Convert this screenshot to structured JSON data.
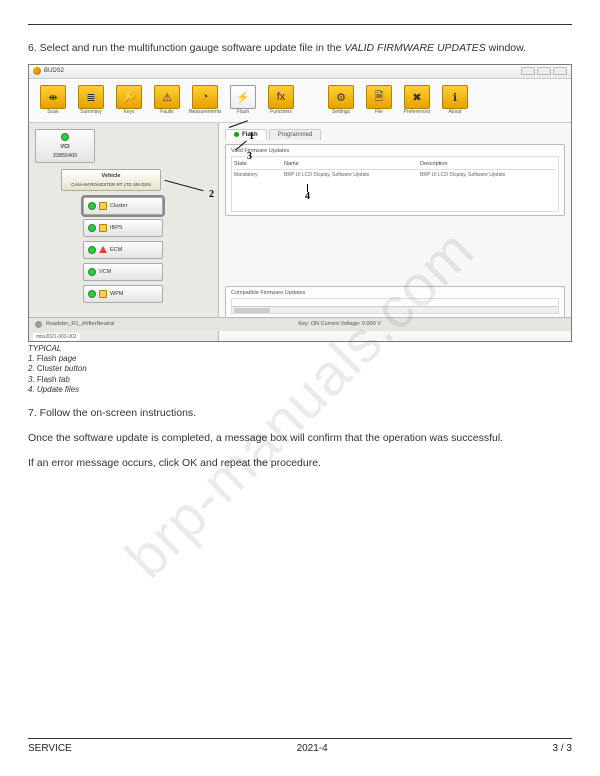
{
  "step6_prefix": "6. Select and run the multifunction gauge software update file in the ",
  "step6_italic": "VALID FIRMWARE UPDATES",
  "step6_suffix": " window.",
  "app_title": "BUDS2",
  "toolbar": [
    {
      "icon": "⇼",
      "label": "Scan"
    },
    {
      "icon": "≣",
      "label": "Summary"
    },
    {
      "icon": "🔑",
      "label": "Keys"
    },
    {
      "icon": "⚠",
      "label": "Faults"
    },
    {
      "icon": "◔",
      "label": "Measurements"
    },
    {
      "icon": "⚡",
      "label": "Flash"
    },
    {
      "icon": "fx",
      "label": "Functions"
    },
    {
      "icon": "⚙",
      "label": "Settings"
    },
    {
      "icon": "🗎",
      "label": "File"
    },
    {
      "icon": "✖",
      "label": "Preferences"
    },
    {
      "icon": "ℹ",
      "label": "About"
    }
  ],
  "tree": {
    "vci": {
      "title": "VCI",
      "sub": "33855400"
    },
    "vehicle": {
      "title": "Vehicle",
      "sub": "CAN-AM ROADSTER RT LTD SM GEN"
    },
    "modules": [
      {
        "name": "Cluster",
        "status": "green",
        "flag": "sp",
        "cls": "cluster"
      },
      {
        "name": "IBPS",
        "status": "green",
        "flag": "sp",
        "cls": ""
      },
      {
        "name": "ECM",
        "status": "green",
        "flag": "tri",
        "cls": ""
      },
      {
        "name": "VCM",
        "status": "green",
        "flag": "",
        "cls": ""
      },
      {
        "name": "WPM",
        "status": "green",
        "flag": "sp",
        "cls": ""
      }
    ]
  },
  "tabs": {
    "flash": "Flash",
    "prog": "Programmed"
  },
  "valid_panel_label": "Valid Firmware Updates",
  "compat_panel_label": "Compatible Firmware Updates",
  "headers": {
    "state": "State",
    "name": "Name",
    "desc": "Description"
  },
  "row": {
    "state": "Mandatory",
    "name": "BRP UI LCD Display, Software Update",
    "desc": "BRP UI LCD Display, Software Update"
  },
  "status_left": "Roadster_R1_shifterNeutral",
  "status_mid": "Key: ON    Current Voltage: 0.000 V",
  "ref": "mbs2021-003-002",
  "typical_head": "TYPICAL",
  "typical": [
    {
      "n": "1.",
      "b": "Flash",
      "i": "page"
    },
    {
      "n": "2.",
      "b": "Cluster",
      "i": "button"
    },
    {
      "n": "3.",
      "b": "Flash",
      "i": "tab"
    },
    {
      "n": "4.",
      "b": "",
      "i": "Update files"
    }
  ],
  "step7": "7. Follow the on-screen instructions.",
  "para1": "Once the software update is completed, a message box will confirm that the operation was successful.",
  "para2": "If an error message occurs, click OK and repeat the procedure.",
  "footer": {
    "left": "SERVICE",
    "mid": "2021-4",
    "right": "3 / 3"
  },
  "watermark": "brp-manuals.com",
  "ann": {
    "n1": "1",
    "n2": "2",
    "n3": "3",
    "n4": "4"
  }
}
